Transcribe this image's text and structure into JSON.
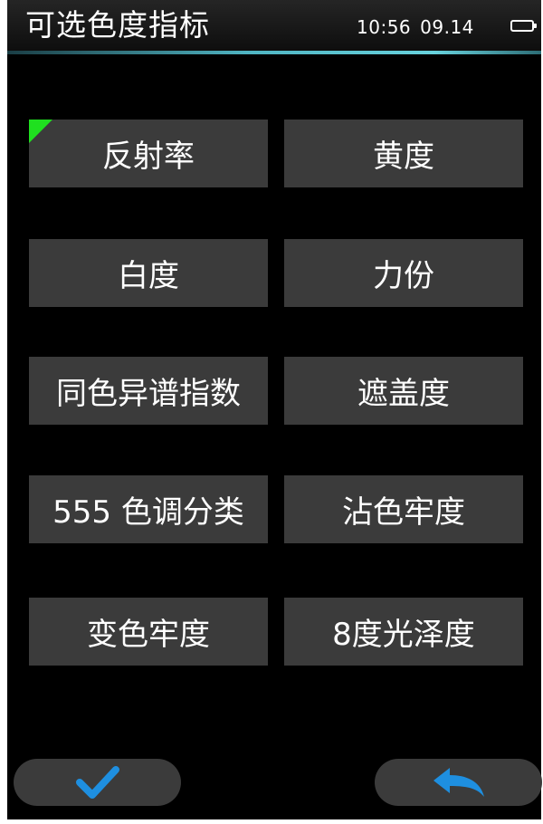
{
  "header": {
    "title": "可选色度指标",
    "time": "10:56",
    "date": "09.14"
  },
  "options": [
    {
      "label": "反射率",
      "selected": true
    },
    {
      "label": "黄度",
      "selected": false
    },
    {
      "label": "白度",
      "selected": false
    },
    {
      "label": "力份",
      "selected": false
    },
    {
      "label": "同色异谱指数",
      "selected": false
    },
    {
      "label": "遮盖度",
      "selected": false
    },
    {
      "label": "555 色调分类",
      "selected": false
    },
    {
      "label": "沾色牢度",
      "selected": false
    },
    {
      "label": "变色牢度",
      "selected": false
    },
    {
      "label": "8度光泽度",
      "selected": false
    }
  ],
  "footer": {
    "confirm_icon": "check-icon",
    "back_icon": "back-arrow-icon"
  },
  "colors": {
    "background": "#000000",
    "button": "#3b3b3b",
    "selected_marker": "#1fe01f",
    "accent": "#1e8fe0",
    "header_line": "#4fb4c2"
  }
}
